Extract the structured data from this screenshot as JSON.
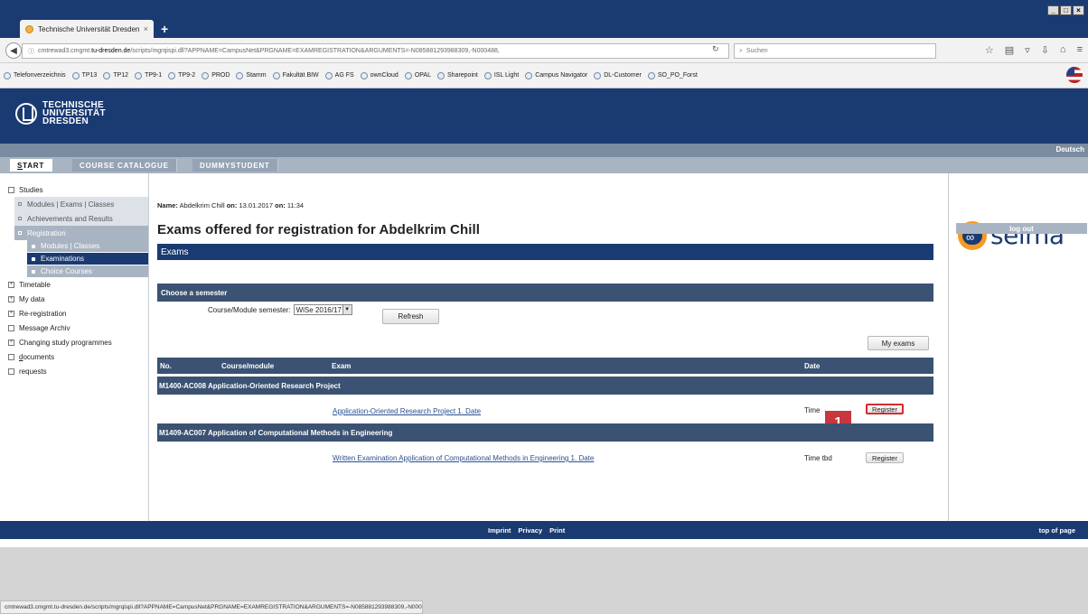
{
  "browser": {
    "tab_title": "Technische Universität Dresden",
    "tab_close": "×",
    "new_tab": "+",
    "url_prefix": "cmtrewad3.cmgmt.",
    "url_host": "tu-dresden.de",
    "url_rest": "/scripts/mgrqispi.dll?APPNAME=CampusNet&PRGNAME=EXAMREGISTRATION&ARGUMENTS=-N085881293988309,-N000488,",
    "search_placeholder": "Suchen",
    "window_controls": [
      "_",
      "□",
      "×"
    ],
    "bookmarks": [
      "Telefonverzeichnis",
      "TP13",
      "TP12",
      "TP9-1",
      "TP9-2",
      "PROD",
      "Stamm",
      "Fakultät BIW",
      "AG FS",
      "ownCloud",
      "OPAL",
      "Sharepoint",
      "ISL Light",
      "Campus Navigator",
      "DL-Customer",
      "SO_PO_Forst"
    ],
    "status_url": "cmtrewad3.cmgmt.tu-dresden.de/scripts/mgrqispi.dll?APPNAME=CampusNet&PRGNAME=EXAMREGISTRATION&ARGUMENTS=-N085881293988309,-N000488,"
  },
  "header": {
    "logo_line1": "TECHNISCHE",
    "logo_line2": "UNIVERSITÄT",
    "logo_line3": "DRESDEN",
    "language_link": "Deutsch"
  },
  "menu": {
    "start_first": "S",
    "start_rest": "TART",
    "course_catalogue": "COURSE CATALOGUE",
    "dummystudent": "DUMMYSTUDENT"
  },
  "sidebar": {
    "studies": "Studies",
    "modules_exams_classes": "Modules | Exams | Classes",
    "achievements": "Achievements and Results",
    "registration": "Registration",
    "reg_modules_classes": "Modules | Classes",
    "reg_examinations": "Examinations",
    "reg_choice_courses": "Choice Courses",
    "timetable": "Timetable",
    "my_data": "My data",
    "re_registration": "Re-registration",
    "message_archiv": "Message Archiv",
    "changing_programmes": "Changing study programmes",
    "documents_first": "d",
    "documents_rest": "ocuments",
    "requests": "requests"
  },
  "main": {
    "name_label": "Name:",
    "name_value": "Abdelkrim Chill",
    "on_label": "on:",
    "date_value": "13.01.2017",
    "on_label2": "on:",
    "time_value": "11:34",
    "title": "Exams offered for registration for Abdelkrim Chill",
    "exams_bar": "Exams",
    "semester_bar": "Choose a semester",
    "semester_label": "Course/Module semester:",
    "semester_value": "WiSe 2016/17",
    "refresh_button": "Refresh",
    "my_exams_button": "My exams",
    "table_headers": {
      "no": "No.",
      "course": "Course/module",
      "exam": "Exam",
      "date": "Date"
    },
    "groups": [
      {
        "title": "M1400-AC008  Application-Oriented Research Project",
        "exam": "Application-Oriented Research Project 1. Date",
        "time": "Time",
        "action": "Register"
      },
      {
        "title": "M1409-AC007  Application of Computational Methods in Engineering",
        "exam": "Written Examination Application of Computational Methods in Engineering 1. Date",
        "time": "Time tbd",
        "action": "Register"
      }
    ],
    "callout_number": "1"
  },
  "right": {
    "selma_word": "selma",
    "logout": "log out"
  },
  "footer": {
    "imprint": "Imprint",
    "privacy": "Privacy",
    "print": "Print",
    "top_of_page": "top of page"
  },
  "colors": {
    "tud_blue": "#1a3a72",
    "table_header": "#3b5273",
    "menu_gray": "#a9b4c2",
    "selma_orange": "#f59a23",
    "highlight_red": "#d8292f"
  }
}
